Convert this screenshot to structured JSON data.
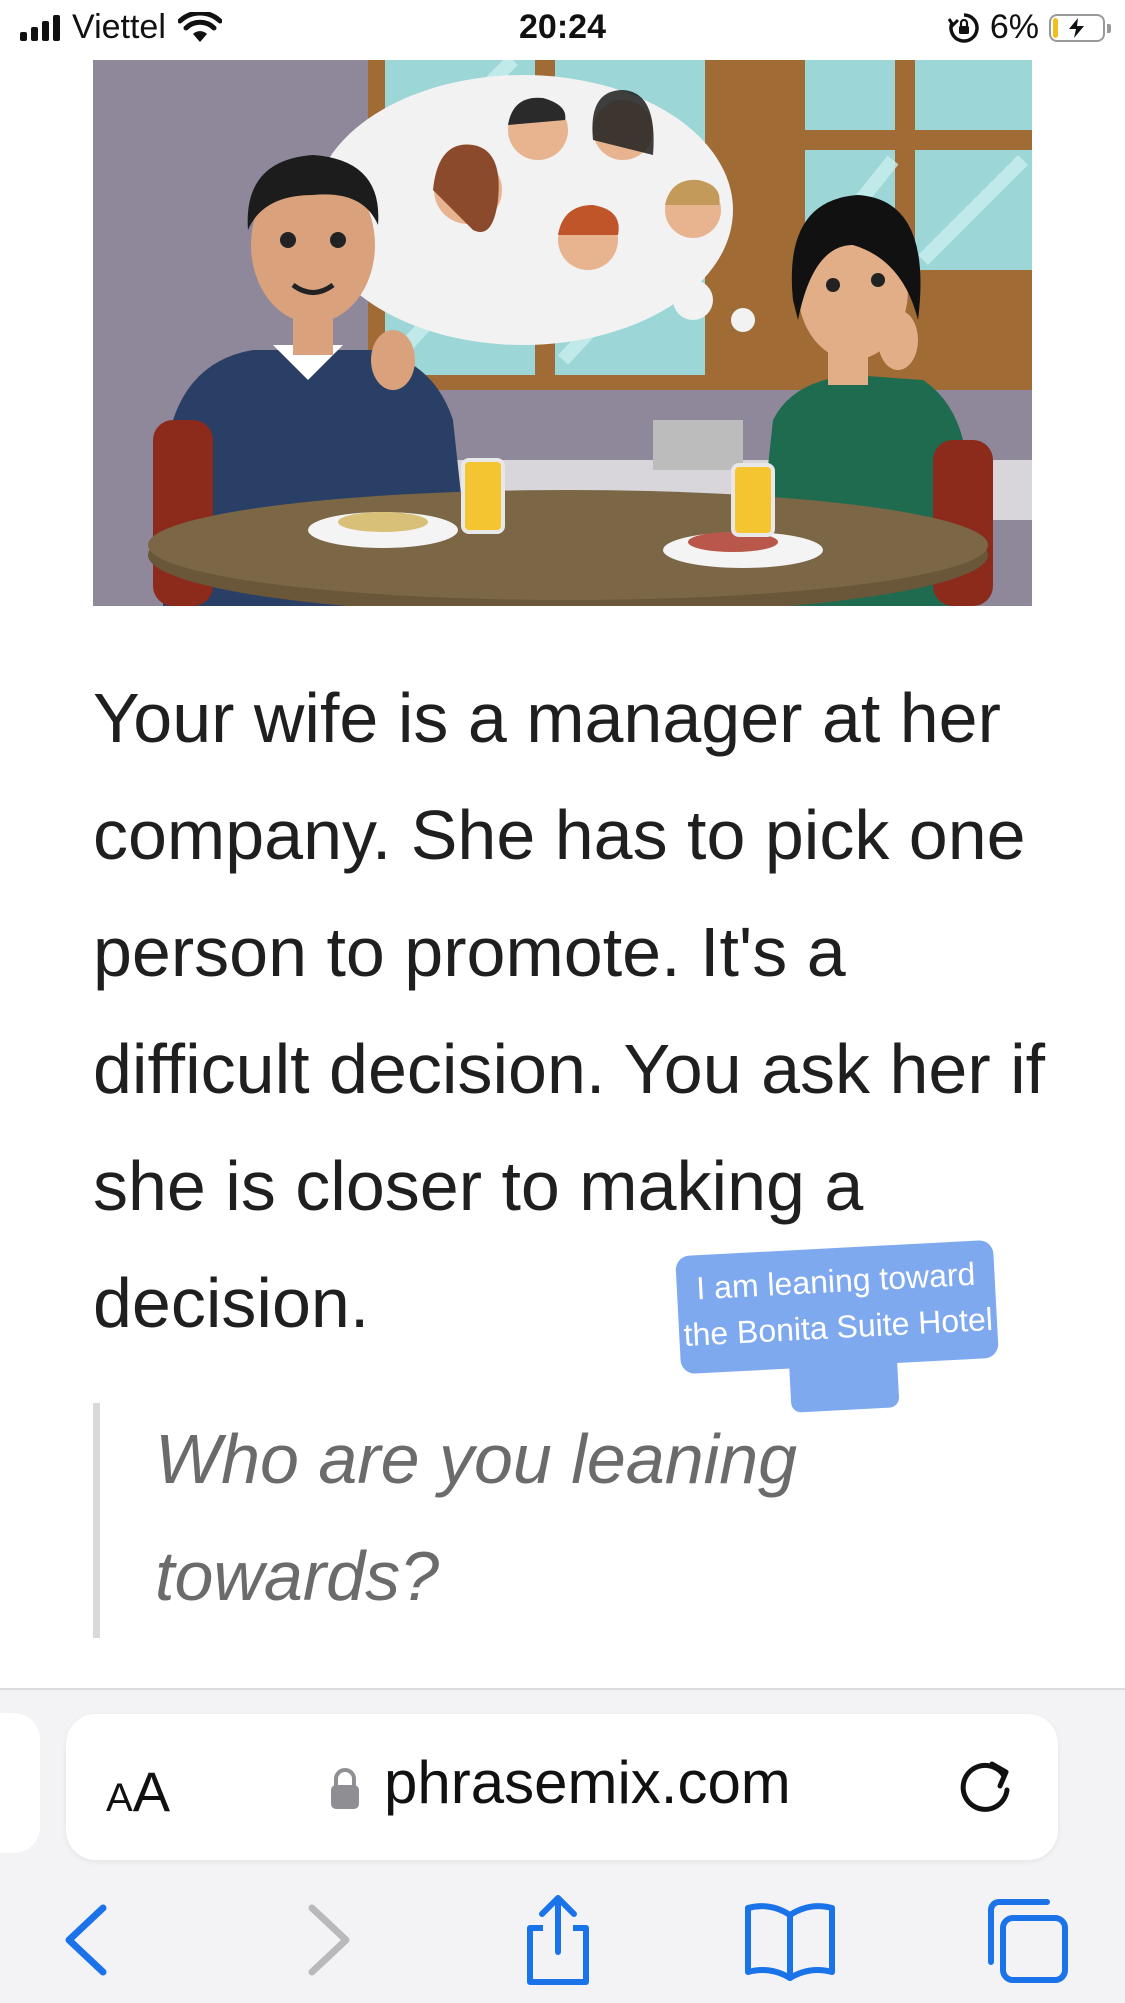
{
  "status_bar": {
    "carrier": "Viettel",
    "time": "20:24",
    "battery_percent": "6%",
    "battery_level": 0.06
  },
  "article": {
    "paragraph": "Your wife is a manager at her company. She has to pick one person to promote. It's a difficult decision. You ask her if she is closer to making a decision.",
    "question": "Who are you leaning towards?"
  },
  "translation_bubble": {
    "text": "I am leaning toward the Bonita Suite Hotel"
  },
  "browser": {
    "text_size_button": {
      "small": "A",
      "large": "A"
    },
    "domain": "phrasemix.com"
  },
  "icons": {
    "signal": "signal-bars-icon",
    "wifi": "wifi-icon",
    "orientation_lock": "orientation-lock-icon",
    "battery": "battery-charging-icon",
    "lock": "lock-icon",
    "reload": "reload-icon",
    "back": "chevron-left-icon",
    "forward": "chevron-right-icon",
    "share": "share-icon",
    "bookmarks": "book-icon",
    "tabs": "tabs-icon"
  },
  "colors": {
    "accent": "#1a73e8",
    "bubble": "#7fa9ee",
    "battery_fill": "#f2c01d"
  }
}
